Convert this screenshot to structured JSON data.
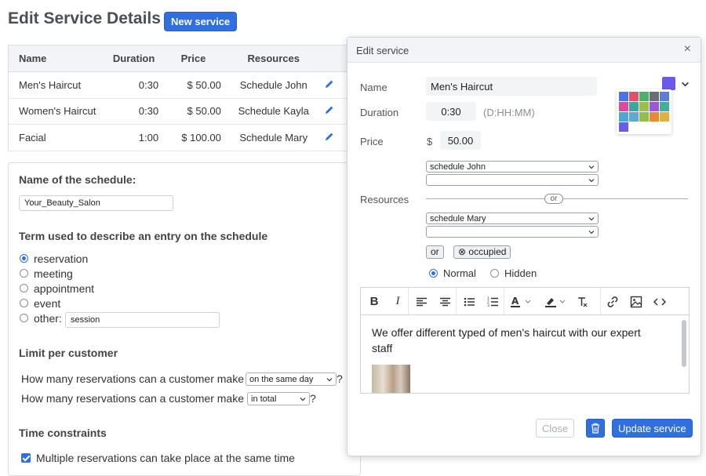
{
  "page": {
    "title": "Edit Service Details",
    "new_service_label": "New service"
  },
  "services_table": {
    "headers": [
      "Name",
      "Duration",
      "Price",
      "Resources"
    ],
    "rows": [
      {
        "name": "Men's Haircut",
        "duration": "0:30",
        "price": "$ 50.00",
        "resources": "Schedule John"
      },
      {
        "name": "Women's Haircut",
        "duration": "0:30",
        "price": "$ 50.00",
        "resources": "Schedule Kayla"
      },
      {
        "name": "Facial",
        "duration": "1:00",
        "price": "$ 100.00",
        "resources": "Schedule Mary"
      }
    ]
  },
  "schedule_settings": {
    "name_label": "Name of the schedule:",
    "name_value": "Your_Beauty_Salon",
    "term_label": "Term used to describe an entry on the schedule",
    "term_options": [
      "reservation",
      "meeting",
      "appointment",
      "event",
      "other:"
    ],
    "term_selected": "reservation",
    "other_value": "session",
    "limit_label": "Limit per customer",
    "limit_row1_text": "How many reservations can a customer make",
    "limit_row1_select": "on the same day",
    "limit_row2_text": "How many reservations can a customer make",
    "limit_row2_select": "in total",
    "question_mark": "?",
    "time_constraints_label": "Time constraints",
    "multiple_label": "Multiple reservations can take place at the same time"
  },
  "dialog": {
    "title": "Edit service",
    "name_label": "Name",
    "name_value": "Men's Haircut",
    "duration_label": "Duration",
    "duration_value": "0:30",
    "duration_hint": "(D:HH:MM)",
    "price_label": "Price",
    "currency": "$",
    "price_value": "50.00",
    "resources_label": "Resources",
    "resource_select_1": "schedule John",
    "resource_select_2": "",
    "or_label": "or",
    "resource_select_3": "schedule Mary",
    "resource_select_4": "",
    "or_button": "or",
    "occupied_button": "⊗ occupied",
    "visibility_normal": "Normal",
    "visibility_hidden": "Hidden",
    "visibility_selected": "Normal",
    "description": "We offer different typed of men's haircut with our expert staff",
    "close_label": "Close",
    "update_label": "Update service",
    "selected_color": "#6a5ce8",
    "palette_colors": [
      "#4a73e8",
      "#e0506a",
      "#4caf6a",
      "#6b6f75",
      "#5b7fd6",
      "#d94aa0",
      "#3aa89e",
      "#9ac04a",
      "#9a5ad8",
      "#3fb0a0",
      "#4aa8d8",
      "#5fa8d0",
      "#8fc14a",
      "#e8893a",
      "#e0b040",
      "#6a5ce8"
    ]
  }
}
